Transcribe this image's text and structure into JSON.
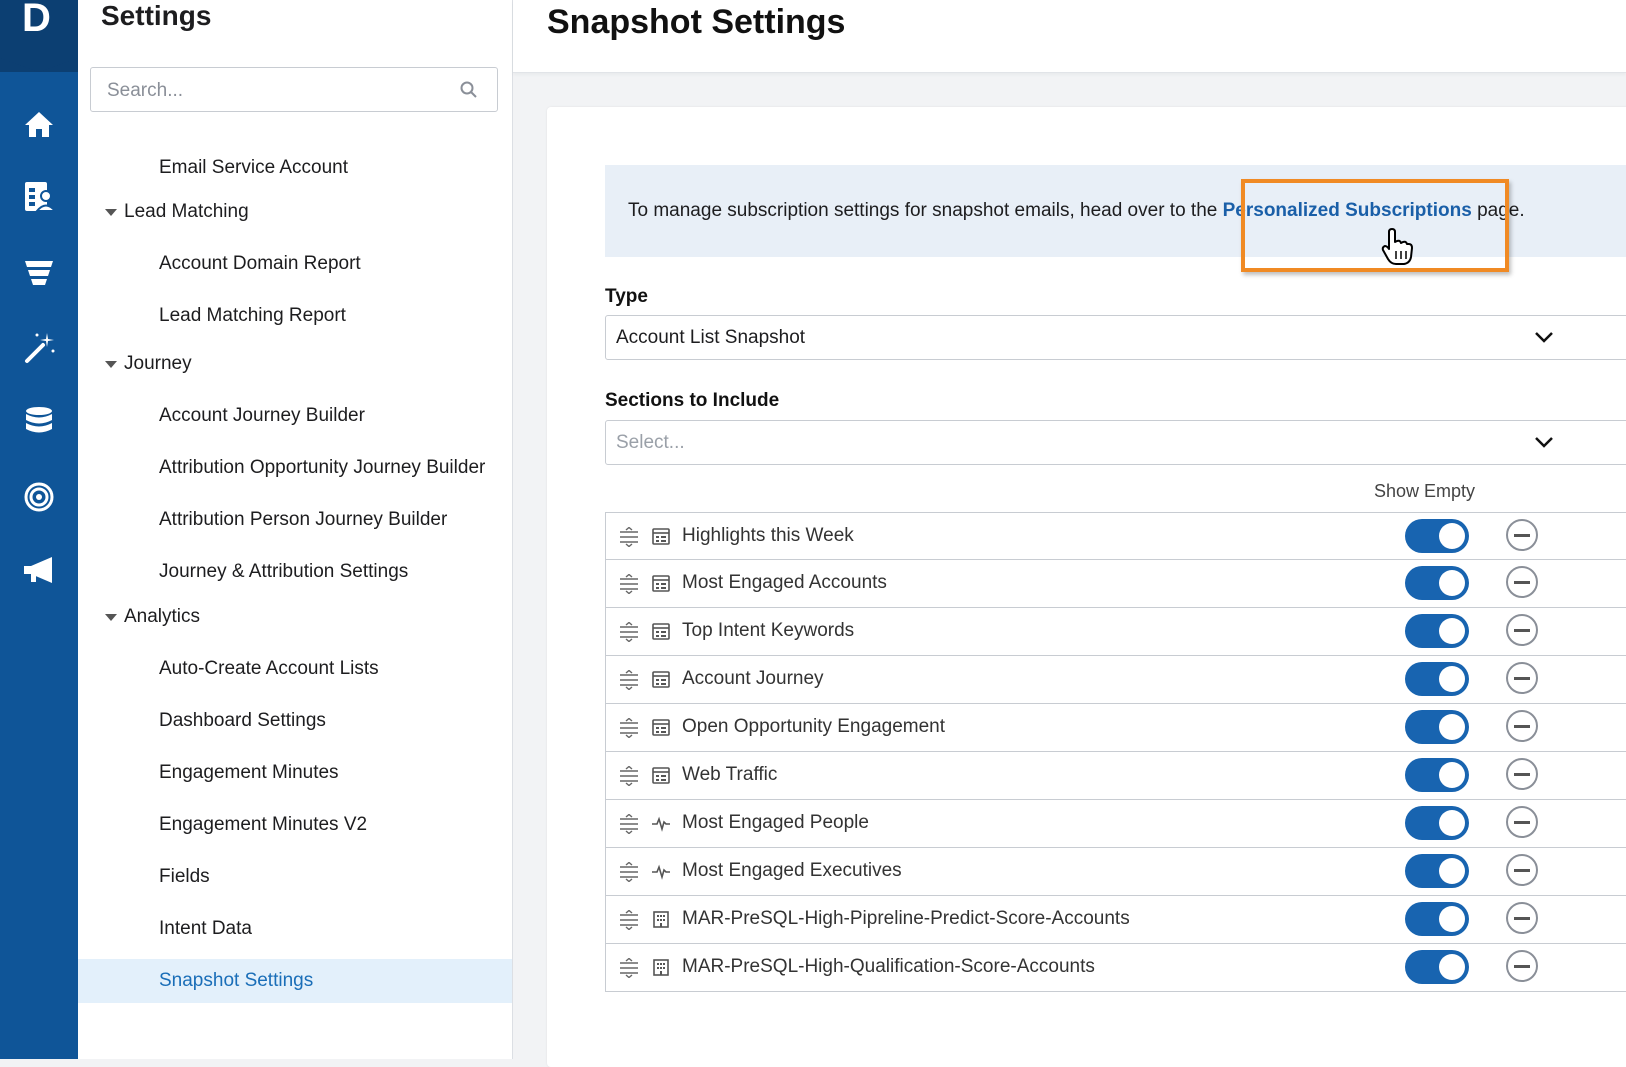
{
  "app": {
    "logo_letter": "D"
  },
  "rail": {
    "icons": [
      "home-icon",
      "contacts-icon",
      "funnel-icon",
      "magic-wand-icon",
      "database-icon",
      "target-icon",
      "megaphone-icon"
    ]
  },
  "panel": {
    "title": "Settings",
    "search_placeholder": "Search...",
    "items": [
      {
        "label": "Email Service Account",
        "kind": "child"
      },
      {
        "label": "Lead Matching",
        "kind": "group"
      },
      {
        "label": "Account Domain Report",
        "kind": "child"
      },
      {
        "label": "Lead Matching Report",
        "kind": "child"
      },
      {
        "label": "Journey",
        "kind": "group"
      },
      {
        "label": "Account Journey Builder",
        "kind": "child"
      },
      {
        "label": "Attribution Opportunity Journey Builder",
        "kind": "child"
      },
      {
        "label": "Attribution Person Journey Builder",
        "kind": "child"
      },
      {
        "label": "Journey & Attribution Settings",
        "kind": "child"
      },
      {
        "label": "Analytics",
        "kind": "group"
      },
      {
        "label": "Auto-Create Account Lists",
        "kind": "child"
      },
      {
        "label": "Dashboard Settings",
        "kind": "child"
      },
      {
        "label": "Engagement Minutes",
        "kind": "child"
      },
      {
        "label": "Engagement Minutes V2",
        "kind": "child"
      },
      {
        "label": "Fields",
        "kind": "child"
      },
      {
        "label": "Intent Data",
        "kind": "child"
      },
      {
        "label": "Snapshot Settings",
        "kind": "child",
        "active": true
      }
    ]
  },
  "header": {
    "title": "Snapshot Settings"
  },
  "info": {
    "text_before": "To manage subscription settings for snapshot emails, head over to the ",
    "link": "Personalized Subscriptions",
    "text_after": " page."
  },
  "type_field": {
    "label": "Type",
    "value": "Account List Snapshot"
  },
  "sections_field": {
    "label": "Sections to Include",
    "placeholder": "Select..."
  },
  "show_empty_label": "Show Empty",
  "sections": [
    {
      "label": "Highlights this Week",
      "icon": "calendar-icon",
      "show_empty": true
    },
    {
      "label": "Most Engaged Accounts",
      "icon": "calendar-icon",
      "show_empty": true
    },
    {
      "label": "Top Intent Keywords",
      "icon": "calendar-icon",
      "show_empty": true
    },
    {
      "label": "Account Journey",
      "icon": "calendar-icon",
      "show_empty": true
    },
    {
      "label": "Open Opportunity Engagement",
      "icon": "calendar-icon",
      "show_empty": true
    },
    {
      "label": "Web Traffic",
      "icon": "calendar-icon",
      "show_empty": true
    },
    {
      "label": "Most Engaged People",
      "icon": "pulse-icon",
      "show_empty": true
    },
    {
      "label": "Most Engaged Executives",
      "icon": "pulse-icon",
      "show_empty": true
    },
    {
      "label": "MAR-PreSQL-High-Pipreline-Predict-Score-Accounts",
      "icon": "building-icon",
      "show_empty": true
    },
    {
      "label": "MAR-PreSQL-High-Qualification-Score-Accounts",
      "icon": "building-icon",
      "show_empty": true
    }
  ],
  "colors": {
    "rail": "#0f5598",
    "accent": "#1864b0",
    "highlight": "#f08a24",
    "active_bg": "#e3f0fb"
  }
}
